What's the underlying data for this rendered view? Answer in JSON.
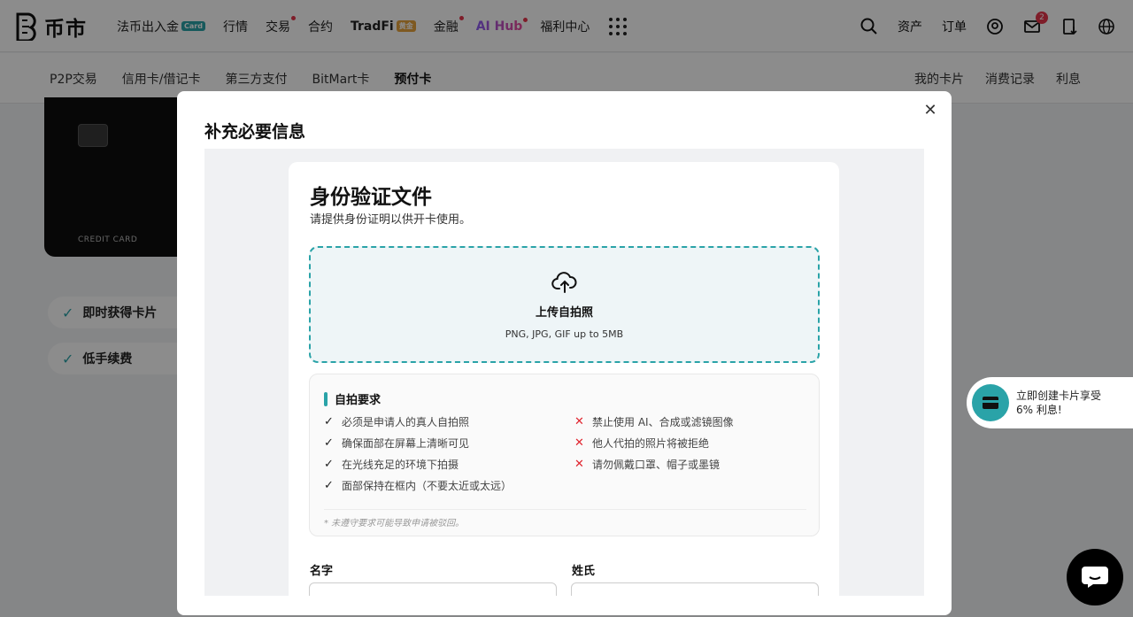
{
  "header": {
    "logo_text": "币市",
    "nav": [
      {
        "label": "法币出入金",
        "badge": "Card"
      },
      {
        "label": "行情"
      },
      {
        "label": "交易"
      },
      {
        "label": "合约"
      },
      {
        "label": "TradFi",
        "badge": "黄金"
      },
      {
        "label": "金融"
      },
      {
        "label": "AI Hub"
      },
      {
        "label": "福利中心"
      }
    ],
    "right": {
      "assets": "资产",
      "orders": "订单",
      "notification_count": "2"
    }
  },
  "subnav": {
    "left": [
      "P2P交易",
      "信用卡/借记卡",
      "第三方支付",
      "BitMart卡",
      "预付卡"
    ],
    "active_index": 4,
    "right": [
      "我的卡片",
      "消费记录",
      "利息"
    ]
  },
  "background": {
    "card_label": "CREDIT CARD",
    "features": [
      "即时获得卡片",
      "低手续费"
    ],
    "promo": "立即创建卡片享受6% 利息!"
  },
  "modal": {
    "title": "补充必要信息",
    "doc": {
      "title": "身份验证文件",
      "subtitle": "请提供身份证明以供开卡使用。",
      "upload_title": "上传自拍照",
      "upload_hint": "PNG, JPG, GIF up to 5MB",
      "requirements_title": "自拍要求",
      "do": [
        "必须是申请人的真人自拍照",
        "确保面部在屏幕上清晰可见",
        "在光线充足的环境下拍摄",
        "面部保持在框内（不要太近或太远）"
      ],
      "dont": [
        "禁止使用 AI、合成或滤镜图像",
        "他人代拍的照片将被拒绝",
        "请勿佩戴口罩、帽子或墨镜"
      ],
      "note": "* 未遵守要求可能导致申请被驳回。",
      "first_name_label": "名字",
      "last_name_label": "姓氏"
    }
  },
  "colors": {
    "accent": "#2aa3a8",
    "error": "#e0252f",
    "notification": "#e6354b"
  }
}
